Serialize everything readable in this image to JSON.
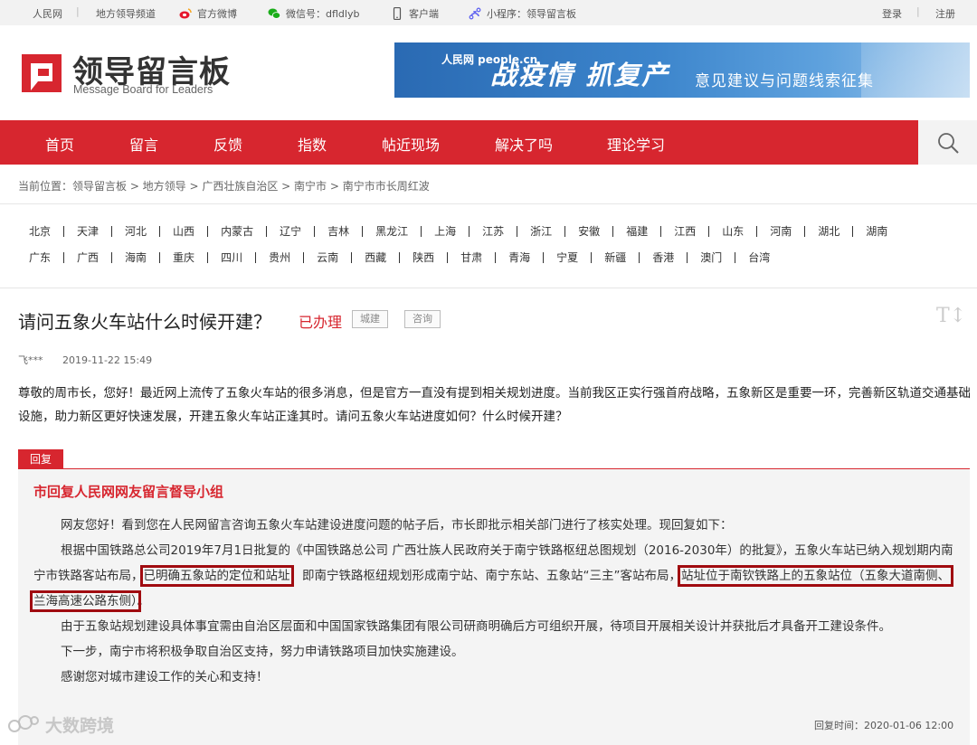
{
  "topbar": {
    "links": [
      "人民网",
      "地方领导频道",
      "官方微博",
      "微信号：dfldlyb",
      "客户端",
      "小程序：领导留言板"
    ],
    "login": "登录",
    "register": "注册"
  },
  "header": {
    "logo_cn": "领导留言板",
    "logo_en": "Message Board for Leaders",
    "banner": {
      "brand": "人民网 people.cn",
      "headline": "战疫情 抓复产",
      "subline": "意见建议与问题线索征集"
    }
  },
  "nav": {
    "items": [
      "首页",
      "留言",
      "反馈",
      "指数",
      "帖近现场",
      "解决了吗",
      "理论学习"
    ]
  },
  "breadcrumb": "当前位置：领导留言板 > 地方领导 > 广西壮族自治区 > 南宁市 > 南宁市市长周红波",
  "regions": {
    "row1": [
      "北京",
      "天津",
      "河北",
      "山西",
      "内蒙古",
      "辽宁",
      "吉林",
      "黑龙江",
      "上海",
      "江苏",
      "浙江",
      "安徽",
      "福建",
      "江西",
      "山东",
      "河南",
      "湖北",
      "湖南"
    ],
    "row2": [
      "广东",
      "广西",
      "海南",
      "重庆",
      "四川",
      "贵州",
      "云南",
      "西藏",
      "陕西",
      "甘肃",
      "青海",
      "宁夏",
      "新疆",
      "香港",
      "澳门",
      "台湾"
    ]
  },
  "post": {
    "title": "请问五象火车站什么时候开建？",
    "status": "已办理",
    "tags": [
      "城建",
      "咨询"
    ],
    "font_toggle": "T↕",
    "author": "飞***",
    "date": "2019-11-22 15:49",
    "content": "尊敬的周市长，您好！最近网上流传了五象火车站的很多消息，但是官方一直没有提到相关规划进度。当前我区正实行强首府战略，五象新区是重要一环，完善新区轨道交通基础设施，助力新区更好快速发展，开建五象火车站正逢其时。请问五象火车站进度如何？什么时候开建？"
  },
  "reply": {
    "tab": "回复",
    "org": "市回复人民网网友留言督导小组",
    "p1": "网友您好！看到您在人民网留言咨询五象火车站建设进度问题的帖子后，市长即批示相关部门进行了核实处理。现回复如下：",
    "p2a": "根据中国铁路总公司2019年7月1日批复的《中国铁路总公司 广西壮族人民政府关于南宁铁路枢纽总图规划（2016-2030年）的批复》，五象火车站已纳入规划期内南宁市铁路客站布局，",
    "p2_hl1": "已明确五象站的定位和站址",
    "p2b": "，即南宁铁路枢纽规划形成南宁站、南宁东站、五象站“三主”客站布局，",
    "p2_hl2": "站址位于南钦铁路上的五象站位（五象大道南侧、兰海高速公路东侧）",
    "p2c": "。",
    "p3": "由于五象站规划建设具体事宜需由自治区层面和中国国家铁路集团有限公司研商明确后方可组织开展，待项目开展相关设计并获批后才具备开工建设条件。",
    "p4": "下一步，南宁市将积极争取自治区支持，努力申请铁路项目加快实施建设。",
    "p5": "感谢您对城市建设工作的关心和支持！",
    "time": "回复时间：2020-01-06 12:00"
  },
  "watermark": "大数跨境"
}
